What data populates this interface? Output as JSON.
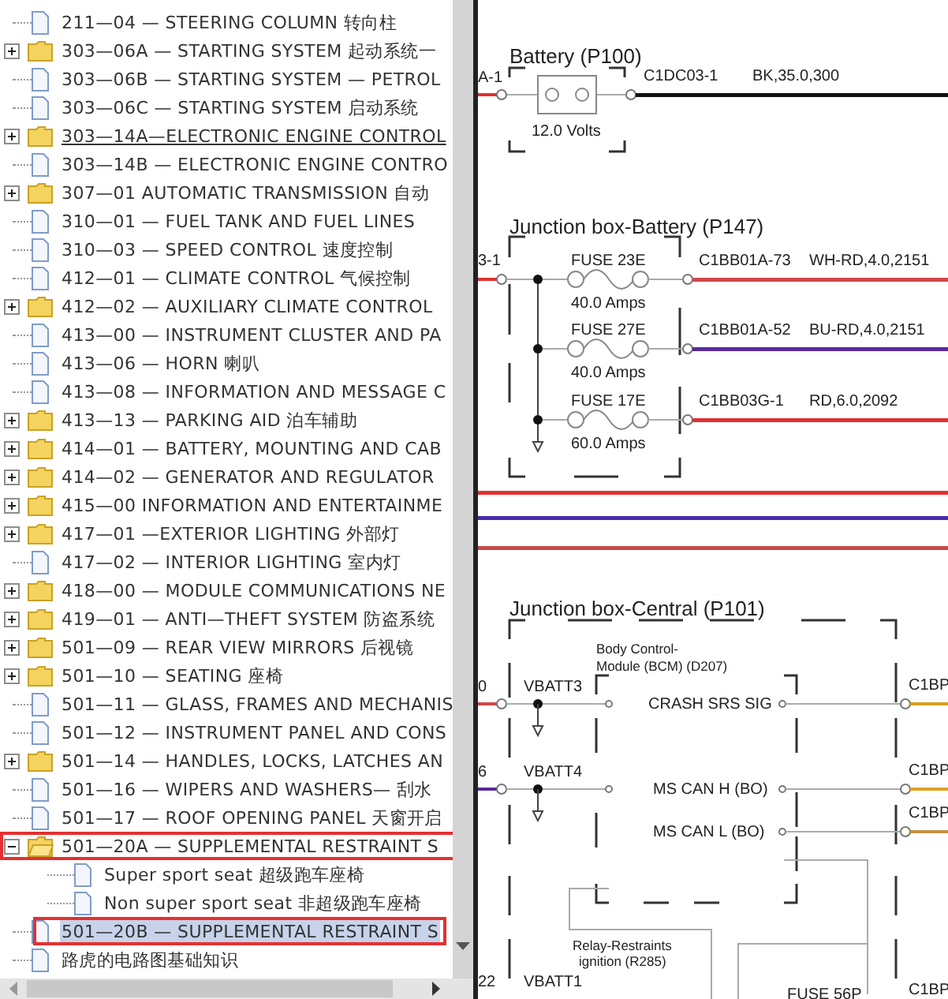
{
  "tree": {
    "items": [
      {
        "kind": "file",
        "label": "211—04 — STEERING COLUMN 转向柱",
        "selected": false,
        "hovered": false,
        "annotated": false
      },
      {
        "kind": "folder",
        "label": "303—06A — STARTING SYSTEM 起动系统一",
        "expanded": false,
        "selected": false,
        "hovered": false,
        "annotated": false
      },
      {
        "kind": "file",
        "label": "303—06B — STARTING SYSTEM — PETROL",
        "selected": false,
        "hovered": false,
        "annotated": false
      },
      {
        "kind": "file",
        "label": "303—06C — STARTING SYSTEM 启动系统",
        "selected": false,
        "hovered": false,
        "annotated": false
      },
      {
        "kind": "folder",
        "label": "303—14A—ELECTRONIC ENGINE CONTROL",
        "expanded": false,
        "selected": false,
        "hovered": true,
        "annotated": false
      },
      {
        "kind": "file",
        "label": "303—14B — ELECTRONIC ENGINE CONTRO",
        "selected": false,
        "hovered": false,
        "annotated": false
      },
      {
        "kind": "folder",
        "label": "307—01 AUTOMATIC TRANSMISSION 自动",
        "expanded": false,
        "selected": false,
        "hovered": false,
        "annotated": false
      },
      {
        "kind": "file",
        "label": "310—01 — FUEL TANK AND FUEL LINES",
        "selected": false,
        "hovered": false,
        "annotated": false
      },
      {
        "kind": "file",
        "label": "310—03 — SPEED CONTROL 速度控制",
        "selected": false,
        "hovered": false,
        "annotated": false
      },
      {
        "kind": "file",
        "label": "412—01 — CLIMATE CONTROL 气候控制",
        "selected": false,
        "hovered": false,
        "annotated": false
      },
      {
        "kind": "folder",
        "label": "412—02 — AUXILIARY CLIMATE CONTROL",
        "expanded": false,
        "selected": false,
        "hovered": false,
        "annotated": false
      },
      {
        "kind": "file",
        "label": "413—00 — INSTRUMENT CLUSTER AND PA",
        "selected": false,
        "hovered": false,
        "annotated": false
      },
      {
        "kind": "file",
        "label": "413—06 — HORN 喇叭",
        "selected": false,
        "hovered": false,
        "annotated": false
      },
      {
        "kind": "file",
        "label": "413—08 — INFORMATION AND MESSAGE C",
        "selected": false,
        "hovered": false,
        "annotated": false
      },
      {
        "kind": "folder",
        "label": "413—13 — PARKING AID 泊车辅助",
        "expanded": false,
        "selected": false,
        "hovered": false,
        "annotated": false
      },
      {
        "kind": "folder",
        "label": "414—01 — BATTERY, MOUNTING AND CAB",
        "expanded": false,
        "selected": false,
        "hovered": false,
        "annotated": false
      },
      {
        "kind": "folder",
        "label": "414—02 — GENERATOR AND REGULATOR",
        "expanded": false,
        "selected": false,
        "hovered": false,
        "annotated": false
      },
      {
        "kind": "folder",
        "label": "415—00 INFORMATION AND ENTERTAINME",
        "expanded": false,
        "selected": false,
        "hovered": false,
        "annotated": false
      },
      {
        "kind": "folder",
        "label": "417—01 —EXTERIOR LIGHTING 外部灯",
        "expanded": false,
        "selected": false,
        "hovered": false,
        "annotated": false
      },
      {
        "kind": "file",
        "label": "417—02 — INTERIOR LIGHTING 室内灯",
        "selected": false,
        "hovered": false,
        "annotated": false
      },
      {
        "kind": "folder",
        "label": "418—00 — MODULE COMMUNICATIONS NE",
        "expanded": false,
        "selected": false,
        "hovered": false,
        "annotated": false
      },
      {
        "kind": "folder",
        "label": "419—01 — ANTI—THEFT SYSTEM 防盗系统",
        "expanded": false,
        "selected": false,
        "hovered": false,
        "annotated": false
      },
      {
        "kind": "folder",
        "label": "501—09 — REAR VIEW MIRRORS 后视镜",
        "expanded": false,
        "selected": false,
        "hovered": false,
        "annotated": false
      },
      {
        "kind": "folder",
        "label": "501—10 — SEATING 座椅",
        "expanded": false,
        "selected": false,
        "hovered": false,
        "annotated": false
      },
      {
        "kind": "file",
        "label": "501—11 — GLASS, FRAMES AND MECHANIS",
        "selected": false,
        "hovered": false,
        "annotated": false
      },
      {
        "kind": "file",
        "label": "501—12 — INSTRUMENT PANEL AND CONS",
        "selected": false,
        "hovered": false,
        "annotated": false
      },
      {
        "kind": "folder",
        "label": "501—14 — HANDLES, LOCKS, LATCHES AN",
        "expanded": false,
        "selected": false,
        "hovered": false,
        "annotated": false
      },
      {
        "kind": "file",
        "label": "501—16 — WIPERS AND WASHERS— 刮水",
        "selected": false,
        "hovered": false,
        "annotated": false
      },
      {
        "kind": "file",
        "label": "501—17 — ROOF OPENING PANEL 天窗开启",
        "selected": false,
        "hovered": false,
        "annotated": false
      },
      {
        "kind": "folder",
        "label": "501—20A — SUPPLEMENTAL RESTRAINT S",
        "expanded": true,
        "selected": false,
        "hovered": false,
        "annotated": true,
        "children": [
          {
            "kind": "file",
            "label": "Super sport seat 超级跑车座椅",
            "selected": false,
            "hovered": false,
            "annotated": false
          },
          {
            "kind": "file",
            "label": "Non super sport seat 非超级跑车座椅",
            "selected": false,
            "hovered": false,
            "annotated": false
          }
        ]
      },
      {
        "kind": "file",
        "label": "501—20B — SUPPLEMENTAL RESTRAINT S",
        "selected": true,
        "hovered": false,
        "annotated": true
      },
      {
        "kind": "file",
        "label": "路虎的电路图基础知识",
        "selected": false,
        "hovered": false,
        "annotated": false
      }
    ]
  },
  "diagram": {
    "battery": {
      "title": "Battery (P100)",
      "left_pin": "A-1",
      "voltage": "12.0 Volts",
      "connector": "C1DC03-1",
      "wire": "BK,35.0,300",
      "color": "#111111"
    },
    "junction_battery": {
      "title": "Junction box-Battery (P147)",
      "left_pin": "3-1",
      "fuses": [
        {
          "name": "FUSE 23E",
          "rating": "40.0 Amps",
          "connector": "C1BB01A-73",
          "wire": "WH-RD,4.0,2151",
          "color": "#d04848"
        },
        {
          "name": "FUSE 27E",
          "rating": "40.0 Amps",
          "connector": "C1BB01A-52",
          "wire": "BU-RD,4.0,2151",
          "color": "#5a2a9a"
        },
        {
          "name": "FUSE 17E",
          "rating": "60.0 Amps",
          "connector": "C1BB03G-1",
          "wire": "RD,6.0,2092",
          "color": "#e03030"
        }
      ]
    },
    "junction_central": {
      "title": "Junction box-Central (P101)",
      "module": [
        "Body Control-",
        "Module (BCM) (D207)"
      ],
      "rows": [
        {
          "left_pin": "0",
          "supply": "VBATT3",
          "signal": "CRASH SRS SIG",
          "connector": "C1BP"
        },
        {
          "left_pin": "6",
          "supply": "VBATT4",
          "signal": "MS CAN H (BO)",
          "connector": "C1BP"
        },
        {
          "signal": "MS CAN L (BO)",
          "connector": "C1BP"
        }
      ],
      "relay": [
        "Relay-Restraints",
        "ignition (R285)"
      ],
      "bottom": {
        "left_pin": "22",
        "supply": "VBATT1",
        "fuse": "FUSE 56P",
        "connector": "C1BP"
      }
    }
  }
}
